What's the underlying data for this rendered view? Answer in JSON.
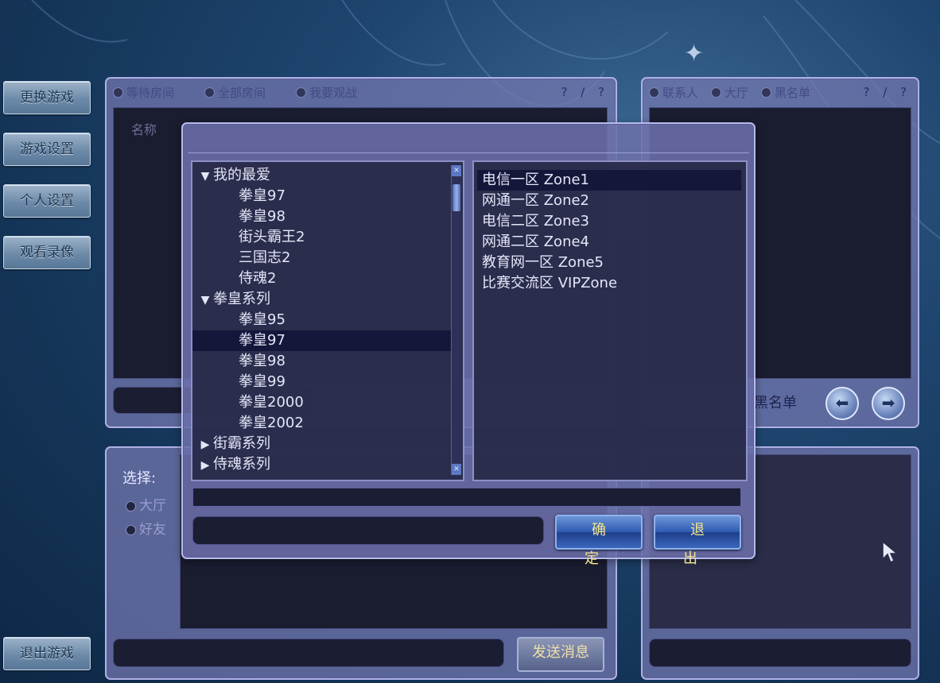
{
  "side_menu": {
    "change_game": "更换游戏",
    "game_settings": "游戏设置",
    "personal_settings": "个人设置",
    "watch_replay": "观看录像",
    "exit_game": "退出游戏"
  },
  "room_panel": {
    "tabs": [
      "等待房间",
      "全部房间",
      "我要观战"
    ],
    "counter": "? / ?",
    "column_name": "名称"
  },
  "friends_panel": {
    "tabs": [
      "联系人",
      "大厅",
      "黑名单"
    ],
    "counter": "? / ?",
    "blacklist_label": "黑名单"
  },
  "chat_panel": {
    "select_label": "选择:",
    "options": [
      "大厅",
      "好友"
    ],
    "send_button": "发送消息"
  },
  "dialog": {
    "tree": [
      {
        "type": "group",
        "label": "我的最爱",
        "expanded": true
      },
      {
        "type": "item",
        "label": "拳皇97"
      },
      {
        "type": "item",
        "label": "拳皇98"
      },
      {
        "type": "item",
        "label": "街头霸王2"
      },
      {
        "type": "item",
        "label": "三国志2"
      },
      {
        "type": "item",
        "label": "侍魂2"
      },
      {
        "type": "group",
        "label": "拳皇系列",
        "expanded": true
      },
      {
        "type": "item",
        "label": "拳皇95"
      },
      {
        "type": "item",
        "label": "拳皇97",
        "selected": true
      },
      {
        "type": "item",
        "label": "拳皇98"
      },
      {
        "type": "item",
        "label": "拳皇99"
      },
      {
        "type": "item",
        "label": "拳皇2000"
      },
      {
        "type": "item",
        "label": "拳皇2002"
      },
      {
        "type": "group",
        "label": "街霸系列",
        "expanded": false
      },
      {
        "type": "group",
        "label": "侍魂系列",
        "expanded": false
      }
    ],
    "zones": [
      {
        "label": "电信一区 Zone1",
        "selected": true
      },
      {
        "label": "网通一区 Zone2"
      },
      {
        "label": "电信二区 Zone3"
      },
      {
        "label": "网通二区 Zone4"
      },
      {
        "label": "教育网一区 Zone5"
      },
      {
        "label": "比赛交流区 VIPZone"
      }
    ],
    "confirm_button": "确 定",
    "exit_button": "退 出"
  },
  "colors": {
    "panel": "#7678b2",
    "dark": "#1a1c30",
    "button_text": "#f4e58a"
  }
}
